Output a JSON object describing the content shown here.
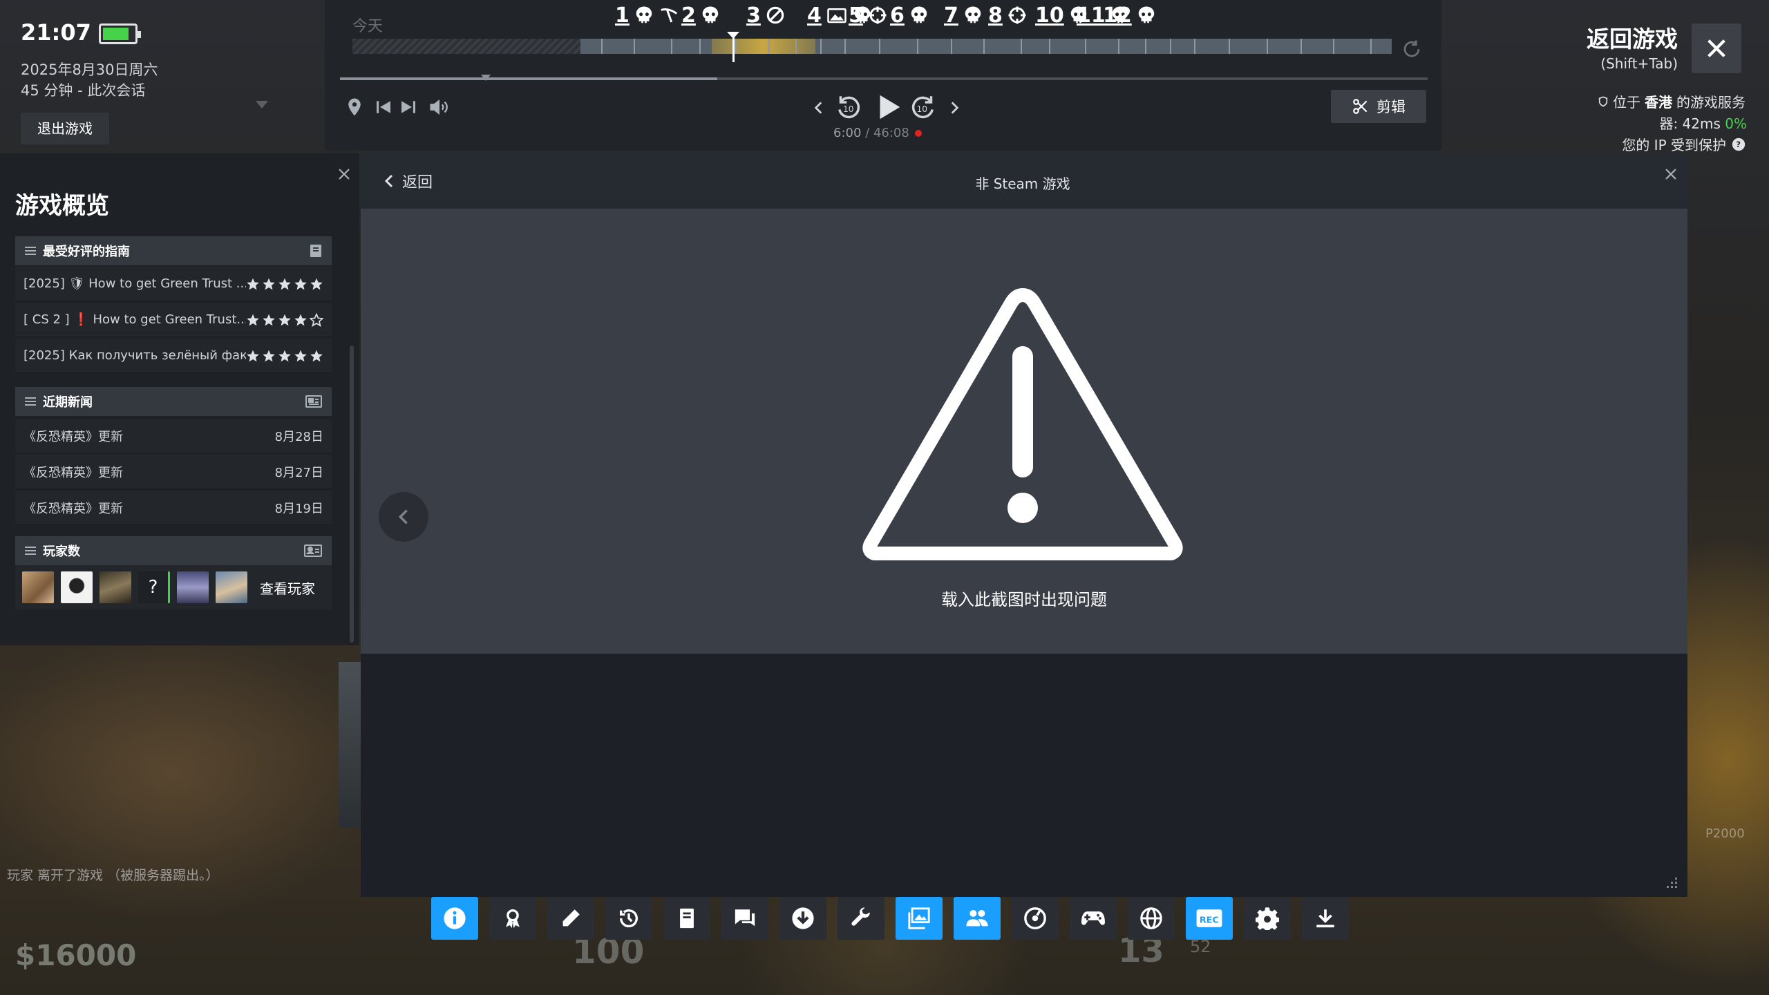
{
  "status": {
    "time": "21:07",
    "date": "2025年8月30日周六",
    "session": "45 分钟 - 此次会话",
    "exit_game": "退出游戏",
    "battery_level": 0.85
  },
  "timeline": {
    "today": "今天",
    "events": [
      {
        "label": "1",
        "icons": [
          "skull-icon",
          "knife-icon"
        ]
      },
      {
        "label": "2",
        "icons": [
          "skull-icon"
        ]
      },
      {
        "label": "3",
        "icons": [
          "blocked-icon"
        ]
      },
      {
        "label": "4",
        "icons": [
          "screenshot-icon",
          "skull-icon"
        ]
      },
      {
        "label": "5",
        "icons": [
          "crosshair-icon"
        ]
      },
      {
        "label": "6",
        "icons": [
          "skull-icon"
        ]
      },
      {
        "label": "7",
        "icons": [
          "skull-icon"
        ]
      },
      {
        "label": "8",
        "icons": [
          "crosshair-icon"
        ]
      },
      {
        "label": "10",
        "icons": [
          "skull-icon"
        ]
      },
      {
        "label": "11",
        "icons": [
          "skull-icon"
        ]
      },
      {
        "label": "12",
        "icons": [
          "skull-icon"
        ]
      }
    ],
    "time_current": "6:00",
    "time_separator": " / ",
    "time_total": "46:08",
    "clip_label": "剪辑"
  },
  "top_right": {
    "return_title": "返回游戏",
    "return_shortcut": "(Shift+Tab)",
    "server_prefix": "位于",
    "server_region": "香港",
    "server_suffix": "的游戏服务",
    "ping_prefix": "器: 42ms",
    "ping_loss": "0%",
    "ip_protect": "您的 IP 受到保护"
  },
  "overview": {
    "title": "游戏概览",
    "guides": {
      "title": "最受好评的指南",
      "items": [
        {
          "text": "[2025] 🛡 How to get Green Trust ...",
          "rating": 5
        },
        {
          "text": "[ CS 2 ] ❗ How to get Green Trust...",
          "rating": 4
        },
        {
          "text": "[2025] Как получить зелёный фак...",
          "rating": 5
        }
      ]
    },
    "news": {
      "title": "近期新闻",
      "items": [
        {
          "title": "《反恐精英》更新",
          "date": "8月28日"
        },
        {
          "title": "《反恐精英》更新",
          "date": "8月27日"
        },
        {
          "title": "《反恐精英》更新",
          "date": "8月19日"
        }
      ]
    },
    "players": {
      "title": "玩家数",
      "see_players": "查看玩家"
    }
  },
  "modal": {
    "back": "返回",
    "title": "非 Steam 游戏",
    "error": "载入此截图时出现问题"
  },
  "toolbar": [
    {
      "icon": "info-icon",
      "active": true
    },
    {
      "icon": "achievements-icon",
      "active": false
    },
    {
      "icon": "notes-icon",
      "active": false
    },
    {
      "icon": "recent-icon",
      "active": false
    },
    {
      "icon": "guides-icon",
      "active": false
    },
    {
      "icon": "chat-icon",
      "active": false
    },
    {
      "icon": "downloads-icon",
      "active": false
    },
    {
      "icon": "settings-wrench-icon",
      "active": false
    },
    {
      "icon": "screenshots-icon",
      "active": true
    },
    {
      "icon": "friends-icon",
      "active": true
    },
    {
      "icon": "music-icon",
      "active": false
    },
    {
      "icon": "controller-icon",
      "active": false
    },
    {
      "icon": "browser-icon",
      "active": false
    },
    {
      "icon": "recording-icon",
      "active": true
    },
    {
      "icon": "gear-icon",
      "active": false
    },
    {
      "icon": "minimize-icon",
      "active": false
    }
  ],
  "game_hud": {
    "message": "玩家 离开了游戏 （被服务器踢出。）",
    "money": "$16000",
    "health": "100",
    "ammo": "13",
    "ammo_reserve": "52",
    "weapon": "P2000"
  },
  "colors": {
    "accent": "#1a9fff",
    "battery": "#46d34a",
    "record": "#e02424",
    "loss_ok": "#46d34a"
  }
}
